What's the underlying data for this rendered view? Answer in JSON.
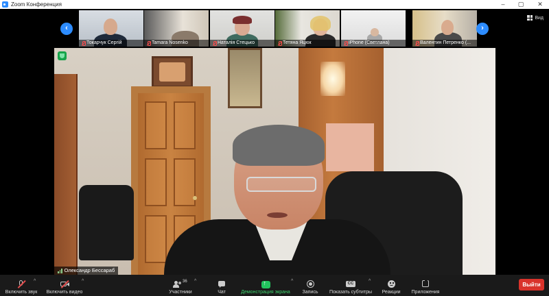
{
  "window": {
    "title": "Zoom Конференция"
  },
  "view_button": {
    "label": "Вид"
  },
  "participants_strip": [
    {
      "name": "Токарчук Сергій",
      "muted": true
    },
    {
      "name": "Tamara Nosenko",
      "muted": true
    },
    {
      "name": "Наталія Стецько",
      "muted": true
    },
    {
      "name": "Тетяна Яцюк",
      "muted": true
    },
    {
      "name": "iPhone (Светлана)",
      "muted": true
    },
    {
      "name": "Валентин Петренко (...",
      "muted": true
    }
  ],
  "active_speaker": {
    "name": "Олександр Бессараб"
  },
  "toolbar": {
    "audio": "Включить звук",
    "video": "Включить видео",
    "participants": "Участники",
    "participants_count": "36",
    "chat": "Чат",
    "share": "Демонстрация экрана",
    "record": "Запись",
    "captions": "Показать субтитры",
    "captions_badge": "CC",
    "reactions": "Реакции",
    "apps": "Приложения",
    "exit": "Выйти"
  },
  "colors": {
    "accent": "#2d8cff",
    "share": "#22c55e",
    "exit": "#d9332b",
    "toolbar": "#1a1a1a"
  }
}
